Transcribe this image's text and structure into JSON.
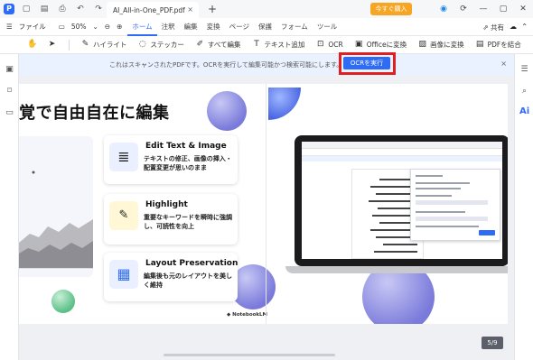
{
  "titlebar": {
    "doc_tab": "AI_All-in-One_PDF.pdf",
    "close_glyph": "×",
    "new_tab_glyph": "+",
    "buy_button": "今すぐ購入"
  },
  "menubar": {
    "file": "ファイル",
    "zoom": "50%",
    "tabs": [
      "ホーム",
      "注釈",
      "編集",
      "変換",
      "ページ",
      "保護",
      "フォーム",
      "ツール"
    ],
    "active_tab": "ホーム",
    "share": "共有"
  },
  "toolbar": {
    "highlight": "ハイライト",
    "sticker": "ステッカー",
    "edit_all": "すべて編集",
    "add_text": "テキスト追加",
    "ocr": "OCR",
    "to_office": "Officeに変換",
    "to_image": "画像に変換",
    "combine_pdf": "PDFを結合"
  },
  "banner": {
    "message": "これはスキャンされたPDFです。OCRを実行して編集可能かつ検索可能にします。",
    "ocr_button": "OCRを実行",
    "close_glyph": "×"
  },
  "page": {
    "headline": "覚で自由自在に編集",
    "features": [
      {
        "title": "Edit Text & Image",
        "desc": "テキストの修正、画像の挿入・配置変更が思いのまま"
      },
      {
        "title": "Highlight",
        "desc": "重要なキーワードを瞬時に強調し、可読性を向上"
      },
      {
        "title": "Layout Preservation",
        "desc": "編集後も元のレイアウトを美しく維持"
      }
    ],
    "notebook_tag": "◆ NotebookLM"
  },
  "page_counter": "5/9",
  "right_rail": {
    "ai_label": "Ai"
  },
  "colors": {
    "accent": "#2f6cf6",
    "buy": "#f6a623",
    "highlight_box": "#e02020"
  }
}
